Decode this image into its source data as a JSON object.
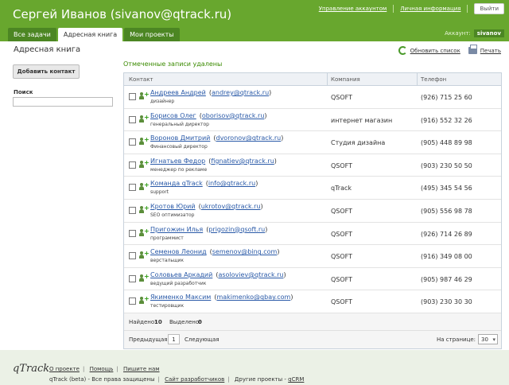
{
  "header": {
    "title": "Сергей Иванов (sivanov@qtrack.ru)",
    "links": [
      "Управление аккаунтом",
      "Личная информация"
    ],
    "exit_label": "Выйти",
    "account_label": "Аккаунт:",
    "account_user": "sivanov",
    "brand_color": "#68a72e"
  },
  "tabs": [
    {
      "label": "Все задачи",
      "active": false
    },
    {
      "label": "Адресная книга",
      "active": true
    },
    {
      "label": "Мои проекты",
      "active": false
    }
  ],
  "sidebar": {
    "page_title": "Адресная книга",
    "add_button": "Добавить контакт",
    "search_label": "Поиск",
    "search_value": ""
  },
  "main": {
    "notice": "Отмеченные записи удалены",
    "refresh_label": "Обновить список",
    "print_label": "Печать",
    "columns": [
      "Контакт",
      "Компания",
      "Телефон"
    ],
    "rows": [
      {
        "name": "Андреев Андрей",
        "email": "andrey@qtrack.ru",
        "title": "дизайнер",
        "company": "QSOFT",
        "phone": "(926) 715 25 60"
      },
      {
        "name": "Борисов Олег",
        "email": "oborisov@qtrack.ru",
        "title": "генеральный директор",
        "company": "интернет магазин",
        "phone": "(916) 552 32 26"
      },
      {
        "name": "Воронов Дмитрий",
        "email": "dvoronov@qtrack.ru",
        "title": "Финансовый директор",
        "company": "Студия дизайна",
        "phone": "(905) 448 89 98"
      },
      {
        "name": "Игнатьев Федор",
        "email": "fignatiev@qtrack.ru",
        "title": "менеджер по рекламе",
        "company": "QSOFT",
        "phone": "(903) 230 50 50"
      },
      {
        "name": "Команда qTrack",
        "email": "info@qtrack.ru",
        "title": "support",
        "company": "qTrack",
        "phone": "(495) 345 54 56"
      },
      {
        "name": "Кротов Юрий",
        "email": "ukrotov@qtrack.ru",
        "title": "SEO оптимизатор",
        "company": "QSOFT",
        "phone": "(905) 556 98 78"
      },
      {
        "name": "Пригожин Илья",
        "email": "prigozin@qsoft.ru",
        "title": "программист",
        "company": "QSOFT",
        "phone": "(926) 714 26 89"
      },
      {
        "name": "Семенов Леонид",
        "email": "semenov@bing.com",
        "title": "верстальщик",
        "company": "QSOFT",
        "phone": "(916) 349 08 00"
      },
      {
        "name": "Соловьев Аркадий",
        "email": "asoloviev@qtrack.ru",
        "title": "ведущий разработчик",
        "company": "QSOFT",
        "phone": "(905) 987 46 29"
      },
      {
        "name": "Якименко Максим",
        "email": "makimenko@qbay.com",
        "title": "тестировщик",
        "company": "QSOFT",
        "phone": "(903) 230 30 30"
      }
    ],
    "found_label": "Найдено:",
    "found_count": "10",
    "selected_label": "Выделено:",
    "selected_count": "0",
    "prev_label": "Предыдущая",
    "page": "1",
    "next_label": "Следующая",
    "per_page_label": "На странице:",
    "per_page": "30"
  },
  "footer": {
    "logo": "qTrack",
    "links": [
      "О проекте",
      "Помощь",
      "Пишите нам"
    ],
    "copyright": "qTrack (beta) - Все права защищены",
    "dev_link": "Сайт разработчиков",
    "other": "Другие проекты -",
    "other_link": "qCRM"
  }
}
